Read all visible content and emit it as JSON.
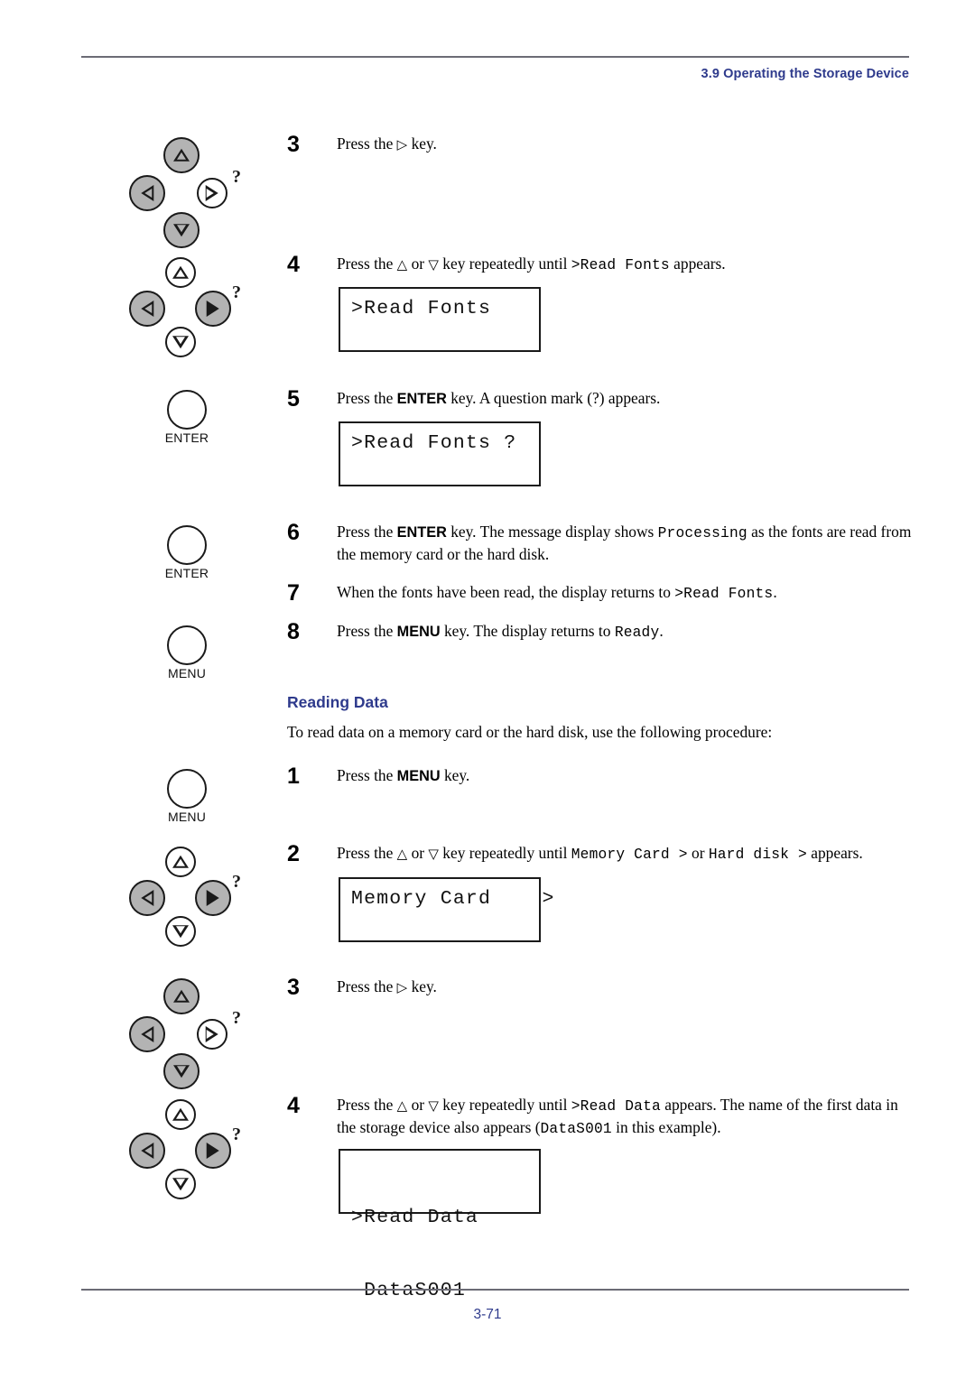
{
  "header": {
    "title": "3.9 Operating the Storage Device"
  },
  "footer": {
    "page_number": "3-71"
  },
  "read_fonts_steps": [
    {
      "number": "3",
      "text_before": "Press the ",
      "glyph": "right-triangle",
      "text_after": " key."
    },
    {
      "number": "4",
      "text_1": "Press the ",
      "text_2": " or ",
      "text_3": " key repeatedly until ",
      "mono": ">Read Fonts",
      "text_4": " appears."
    },
    {
      "number": "5",
      "text_1": "Press the ",
      "kbd": "ENTER",
      "text_2": " key. A question mark (",
      "qm": "?",
      "text_3": ") appears."
    },
    {
      "number": "6",
      "text_1": "Press the ",
      "kbd": "ENTER",
      "text_2": " key. The message display shows ",
      "mono": "Processing",
      "text_3": " as the fonts are read from the memory card or the hard disk."
    },
    {
      "number": "7",
      "text_1": "When the fonts have been read, the display returns to ",
      "mono": ">Read Fonts",
      "text_2": "."
    },
    {
      "number": "8",
      "text_1": "Press the ",
      "kbd": "MENU",
      "text_2": " key. The display returns to ",
      "mono": "Ready",
      "text_3": "."
    }
  ],
  "displays": {
    "read_fonts": ">Read Fonts",
    "read_fonts_q": ">Read Fonts ?",
    "memory_card": "Memory Card    >",
    "read_data_line1": ">Read Data",
    "read_data_line2": " DataS001"
  },
  "reading_data_section": {
    "heading": "Reading Data",
    "intro": "To read data on a memory card or the hard disk, use the following procedure:",
    "steps": [
      {
        "number": "1",
        "text_1": "Press the ",
        "kbd": "MENU",
        "text_2": " key."
      },
      {
        "number": "2",
        "text_1": "Press the ",
        "text_2": " or ",
        "text_3": " key repeatedly until ",
        "mono_a": "Memory Card >",
        "text_4": " or ",
        "mono_b": "Hard disk >",
        "text_5": " appears."
      },
      {
        "number": "3",
        "text_before": "Press the ",
        "glyph": "right-triangle",
        "text_after": " key."
      },
      {
        "number": "4",
        "text_1": "Press the ",
        "text_2": " or ",
        "text_3": " key repeatedly until ",
        "mono_a": ">Read Data",
        "text_4": " appears. The name of the first data in the storage device also appears (",
        "mono_b": "DataS001",
        "text_5": " in this example)."
      }
    ]
  },
  "key_labels": {
    "enter": "ENTER",
    "menu": "MENU",
    "question_mark": "?"
  },
  "colors": {
    "heading_blue": "#2e3a8c",
    "key_gray": "#b3b3b3",
    "rule_gray": "#6b6b75"
  }
}
